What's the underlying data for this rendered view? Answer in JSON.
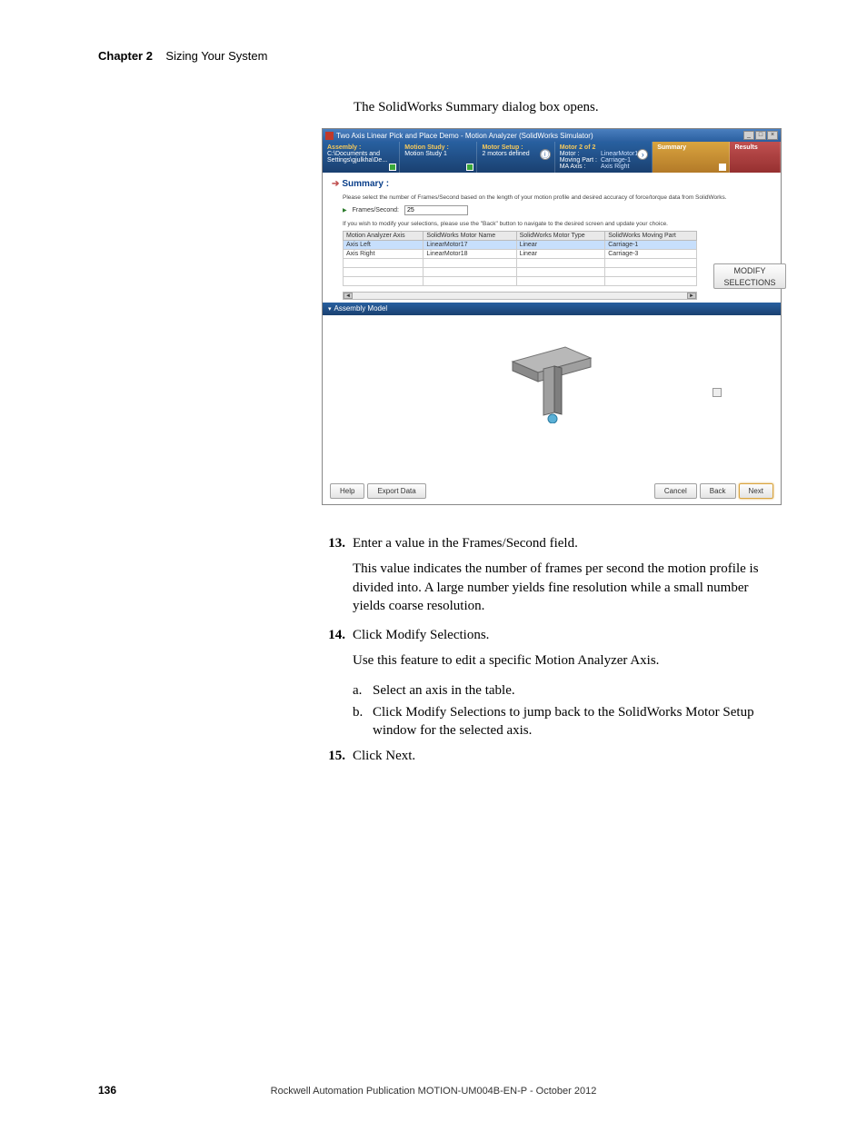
{
  "header": {
    "chapter": "Chapter 2",
    "title": "Sizing Your System"
  },
  "intro": "The SolidWorks Summary dialog box opens.",
  "shot": {
    "title": "Two Axis Linear Pick and Place Demo - Motion Analyzer (SolidWorks Simulator)",
    "wizard": {
      "assembly": {
        "t": "Assembly :",
        "l1": "C:\\Documents and",
        "l2": "Settings\\gjulkha\\De..."
      },
      "motion_study": {
        "t": "Motion Study :",
        "l1": "Motion Study 1"
      },
      "motor_setup": {
        "t": "Motor Setup :",
        "l1": "2 motors defined"
      },
      "motor_n": {
        "t": "Motor 2 of 2",
        "l1": "Motor :",
        "l2": "Moving Part :",
        "l3": "MA Axis :",
        "r1": "LinearMotor18",
        "r2": "Carriage-1",
        "r3": "Axis Right"
      },
      "summary": "Summary",
      "results": "Results"
    },
    "summary_section": {
      "title": "Summary :",
      "note1": "Please select the number of Frames/Second based on the length of your motion profile and desired accuracy of force/torque data from SolidWorks.",
      "fs_label": "Frames/Second:",
      "fs_value": "25",
      "note2": "If you wish to modify your selections, please use the \"Back\" button to navigate to the desired screen and update your choice.",
      "table": {
        "headers": [
          "Motion Analyzer Axis",
          "SolidWorks Motor Name",
          "SolidWorks Motor Type",
          "SolidWorks Moving Part"
        ],
        "rows": [
          [
            "Axis Left",
            "LinearMotor17",
            "Linear",
            "Carriage-1"
          ],
          [
            "Axis Right",
            "LinearMotor18",
            "Linear",
            "Carriage-3"
          ]
        ]
      },
      "modify": "MODIFY SELECTIONS"
    },
    "assembly_model": "Assembly Model",
    "buttons": {
      "help": "Help",
      "export": "Export Data",
      "cancel": "Cancel",
      "back": "Back",
      "next": "Next"
    }
  },
  "body": {
    "s13": {
      "n": "13.",
      "t": "Enter a value in the Frames/Second field."
    },
    "p13": "This value indicates the number of frames per second the motion profile is divided into. A large number yields fine resolution while a small number yields coarse resolution.",
    "s14": {
      "n": "14.",
      "t": "Click Modify Selections."
    },
    "p14": "Use this feature to edit a specific Motion Analyzer Axis.",
    "sa": {
      "l": "a.",
      "t": "Select an axis in the table."
    },
    "sb": {
      "l": "b.",
      "t": "Click Modify Selections to jump back to the SolidWorks Motor Setup window for the selected axis."
    },
    "s15": {
      "n": "15.",
      "t": "Click Next."
    }
  },
  "page": "136",
  "footer": "Rockwell Automation Publication MOTION-UM004B-EN-P - October 2012"
}
